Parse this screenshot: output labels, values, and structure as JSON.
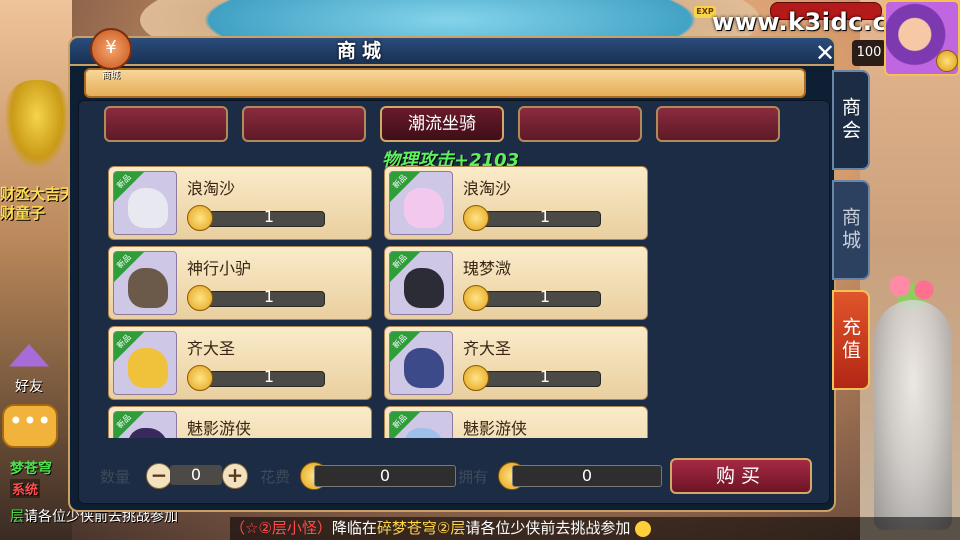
{
  "watermark": "www.k3idc.com",
  "hud": {
    "exp_label": "EXP",
    "level": "100"
  },
  "panel": {
    "title": "商城",
    "close_symbol": "✕",
    "shop_badge_label": "商城"
  },
  "category_tabs": [
    {
      "label": "",
      "active": false
    },
    {
      "label": "",
      "active": false
    },
    {
      "label": "潮流坐骑",
      "active": true
    },
    {
      "label": "",
      "active": false
    },
    {
      "label": "",
      "active": false
    }
  ],
  "bonus_text": "物理攻击+2103",
  "items": [
    {
      "name": "浪淘沙",
      "price": "1",
      "tag": "新品",
      "color": "#e8e8f0"
    },
    {
      "name": "浪淘沙",
      "price": "1",
      "tag": "新品",
      "color": "#f2c8ee"
    },
    {
      "name": "神行小驴",
      "price": "1",
      "tag": "新品",
      "color": "#6b5a4a"
    },
    {
      "name": "瑰梦溦",
      "price": "1",
      "tag": "新品",
      "color": "#2c2c36"
    },
    {
      "name": "齐大圣",
      "price": "1",
      "tag": "新品",
      "color": "#f0c13a"
    },
    {
      "name": "齐大圣",
      "price": "1",
      "tag": "新品",
      "color": "#3d4a8a"
    },
    {
      "name": "魅影游侠",
      "price": "",
      "tag": "新品",
      "color": "#3a2a5c"
    },
    {
      "name": "魅影游侠",
      "price": "",
      "tag": "新品",
      "color": "#9ec0ea"
    }
  ],
  "side_tabs": {
    "guild": "商会",
    "shop": "商城",
    "recharge": "充值"
  },
  "purchase": {
    "quantity_label": "数量",
    "quantity": "0",
    "minus": "−",
    "plus": "+",
    "cost_label": "花费",
    "cost": "0",
    "balance_label": "拥有",
    "balance": "0",
    "buy_label": "购买"
  },
  "left_panel": {
    "name1": "财丞大吉天",
    "name2": "财童子",
    "friend_label": "好友",
    "chat_icon": "•••",
    "chat_player": "梦苍穹",
    "system_tag": "系统",
    "chat_prefix": "层",
    "chat_text": "请各位少侠前去挑战参加"
  },
  "broadcast": {
    "tag": "（☆②层小怪）",
    "pre": "降临在",
    "place": "碎梦苍穹②层",
    "post": "请各位少侠前去挑战参加"
  }
}
